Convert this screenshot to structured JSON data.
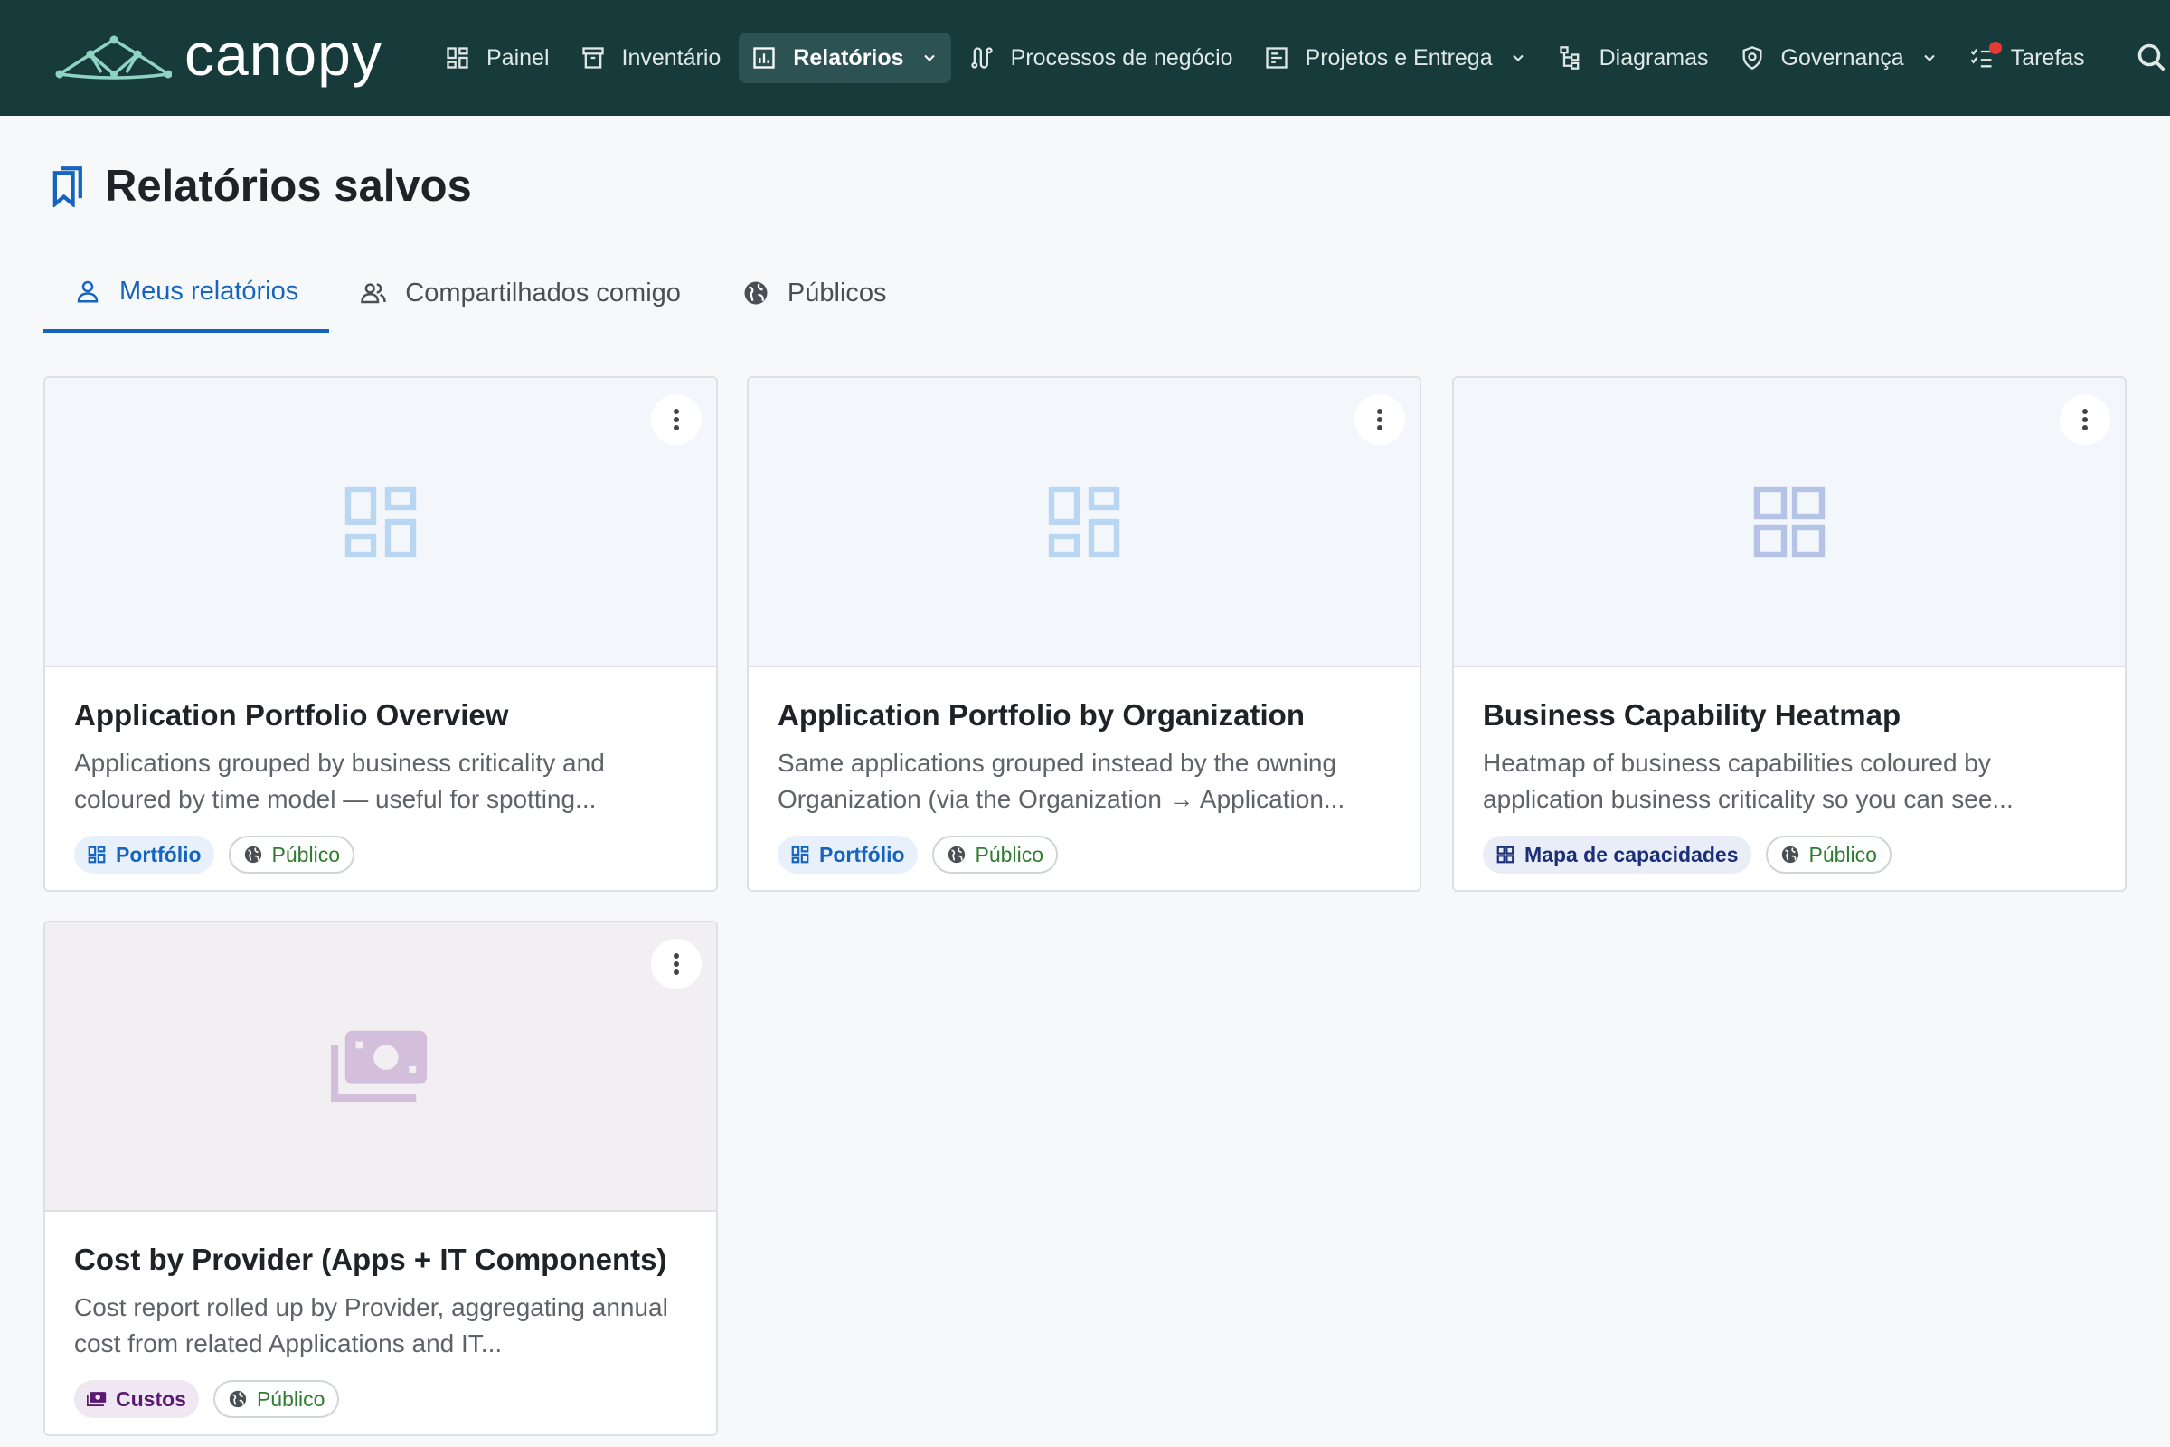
{
  "app": {
    "name": "canopy"
  },
  "nav": {
    "items": [
      {
        "label": "Painel",
        "icon": "dashboard-icon"
      },
      {
        "label": "Inventário",
        "icon": "archive-icon"
      },
      {
        "label": "Relatórios",
        "icon": "bar-chart-icon",
        "active": true,
        "has_dropdown": true
      },
      {
        "label": "Processos de negócio",
        "icon": "route-icon"
      },
      {
        "label": "Projetos e Entrega",
        "icon": "project-icon",
        "has_dropdown": true
      },
      {
        "label": "Diagramas",
        "icon": "hierarchy-icon"
      },
      {
        "label": "Governança",
        "icon": "shield-icon",
        "has_dropdown": true
      },
      {
        "label": "Tarefas",
        "icon": "checklist-icon",
        "has_notification": true
      }
    ],
    "search_icon": "search-icon"
  },
  "page": {
    "title": "Relatórios salvos",
    "icon": "bookmark-icon"
  },
  "tabs": [
    {
      "label": "Meus relatórios",
      "icon": "person-icon",
      "active": true
    },
    {
      "label": "Compartilhados comigo",
      "icon": "people-icon"
    },
    {
      "label": "Públicos",
      "icon": "globe-icon"
    }
  ],
  "cards": [
    {
      "title": "Application Portfolio Overview",
      "description": "Applications grouped by business criticality and coloured by time model — useful for spotting...",
      "type_label": "Portfólio",
      "visibility_label": "Público",
      "thumb_icon": "dashboard-icon"
    },
    {
      "title": "Application Portfolio by Organization",
      "description": "Same applications grouped instead by the owning Organization (via the Organization → Application...",
      "type_label": "Portfólio",
      "visibility_label": "Público",
      "thumb_icon": "dashboard-icon"
    },
    {
      "title": "Business Capability Heatmap",
      "description": "Heatmap of business capabilities coloured by application business criticality so you can see...",
      "type_label": "Mapa de capacidades",
      "visibility_label": "Público",
      "thumb_icon": "grid-icon"
    },
    {
      "title": "Cost by Provider (Apps + IT Components)",
      "description": "Cost report rolled up by Provider, aggregating annual cost from related Applications and IT...",
      "type_label": "Custos",
      "visibility_label": "Público",
      "thumb_icon": "money-icon"
    }
  ],
  "colors": {
    "topbar": "#173a3b",
    "accent": "#1565c0",
    "public_green": "#2e7d32",
    "notification": "#e53935"
  }
}
